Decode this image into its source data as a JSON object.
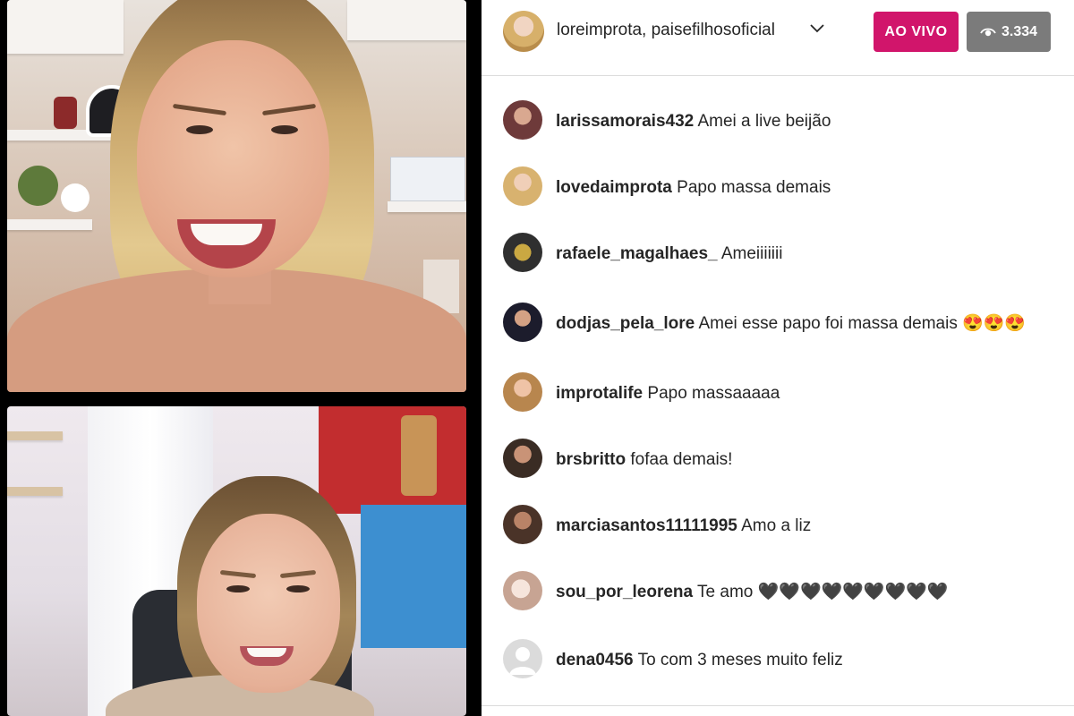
{
  "stream": {
    "host_names": "loreimprota, paisefilhosoficial",
    "live_label": "AO VIVO",
    "viewer_count": "3.334"
  },
  "comments": [
    {
      "username": "larissamorais432",
      "text": "Amei a live beijão",
      "avatar_color": "#6e3a3a"
    },
    {
      "username": "lovedaimprota",
      "text": "Papo massa demais",
      "avatar_color": "#e7b9a1"
    },
    {
      "username": "rafaele_magalhaes_",
      "text": "Ameiiiiiii",
      "avatar_color": "#6f5a2a"
    },
    {
      "username": "dodjas_pela_lore",
      "text": "Amei esse papo foi massa demais 😍😍😍",
      "avatar_color": "#1c1c2c"
    },
    {
      "username": "improtalife",
      "text": "Papo massaaaaa",
      "avatar_color": "#c99a68"
    },
    {
      "username": "brsbritto",
      "text": "fofaa demais!",
      "avatar_color": "#3a2c24"
    },
    {
      "username": "marciasantos11111995",
      "text": "Amo a liz",
      "avatar_color": "#4a3328"
    },
    {
      "username": "sou_por_leorena",
      "text": "Te amo 🖤🖤🖤🖤🖤🖤🖤🖤🖤",
      "avatar_color": "#e8d6cf"
    },
    {
      "username": "dena0456",
      "text": "To com 3 meses muito feliz",
      "avatar_color": "#dbdbdb"
    }
  ],
  "colors": {
    "live_badge": "#d1156b",
    "viewer_badge": "#7b7b7b",
    "text": "#262626",
    "divider": "#dbdbdb"
  },
  "icons": {
    "viewer": "eye-icon",
    "expand": "chevron-down-icon",
    "default_avatar": "user-silhouette-icon"
  }
}
